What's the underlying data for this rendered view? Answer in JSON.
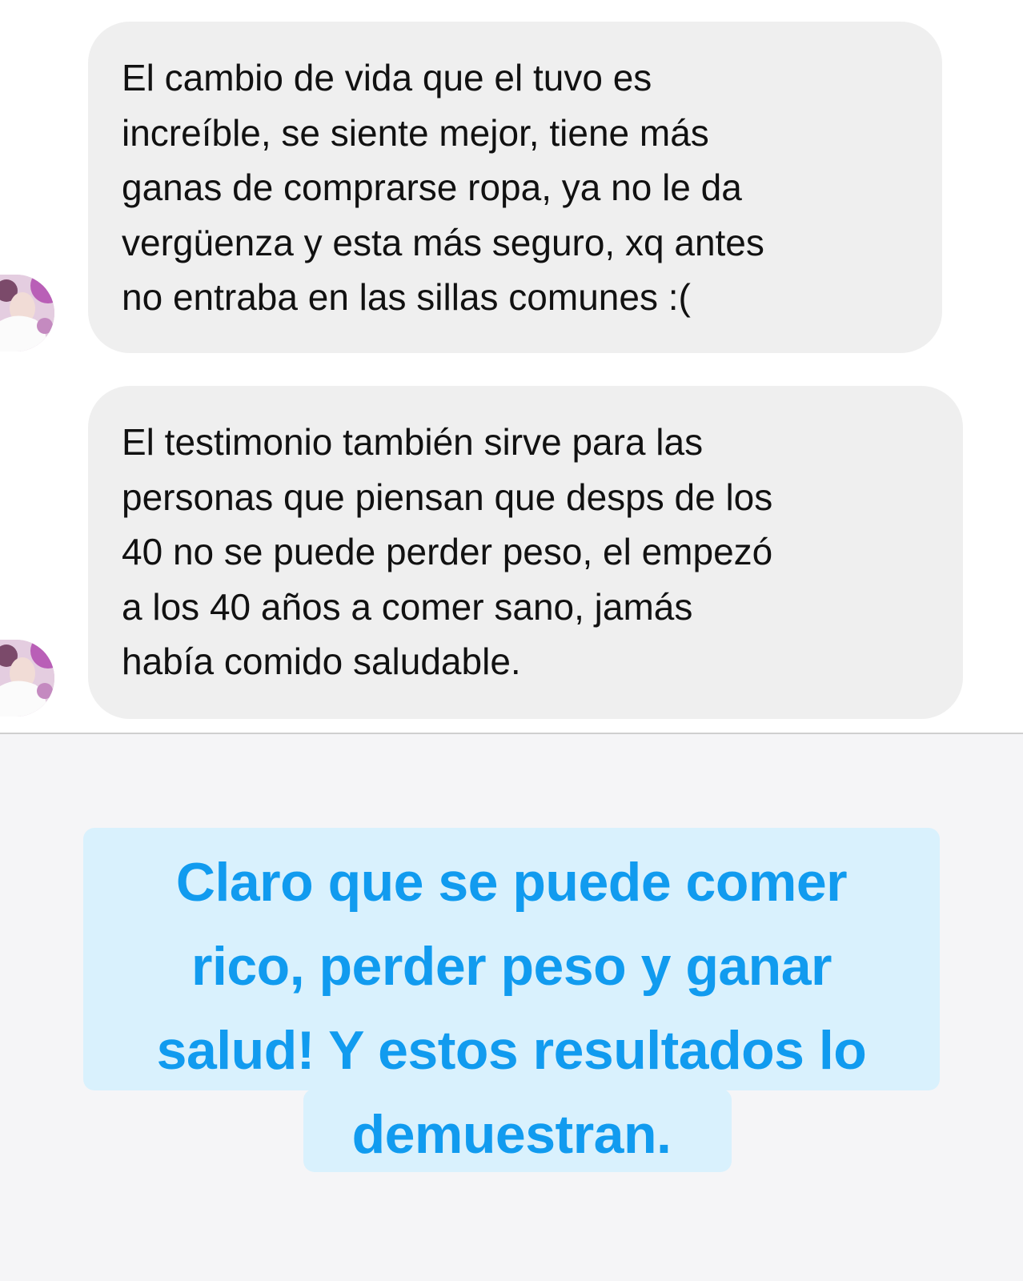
{
  "messages": [
    {
      "lines": [
        "El cambio de vida que el tuvo es",
        "increíble, se siente mejor, tiene más",
        "ganas de comprarse ropa, ya no le da",
        "vergüenza y esta más seguro, xq antes",
        "no entraba en las sillas comunes :("
      ]
    },
    {
      "lines": [
        "El testimonio también sirve para las",
        "personas que piensan que desps de los",
        "40 no se puede perder peso, el empezó",
        "a los 40 años a comer sano, jamás",
        "había comido saludable."
      ]
    }
  ],
  "caption": {
    "lines": [
      "Claro que se puede comer",
      "rico, perder peso y ganar",
      "salud! Y estos resultados lo",
      "demuestran."
    ]
  },
  "colors": {
    "bubble_background": "#efefef",
    "caption_text": "#119bef",
    "caption_highlight": "#d9f1fd",
    "caption_area_background": "#f5f5f7"
  }
}
